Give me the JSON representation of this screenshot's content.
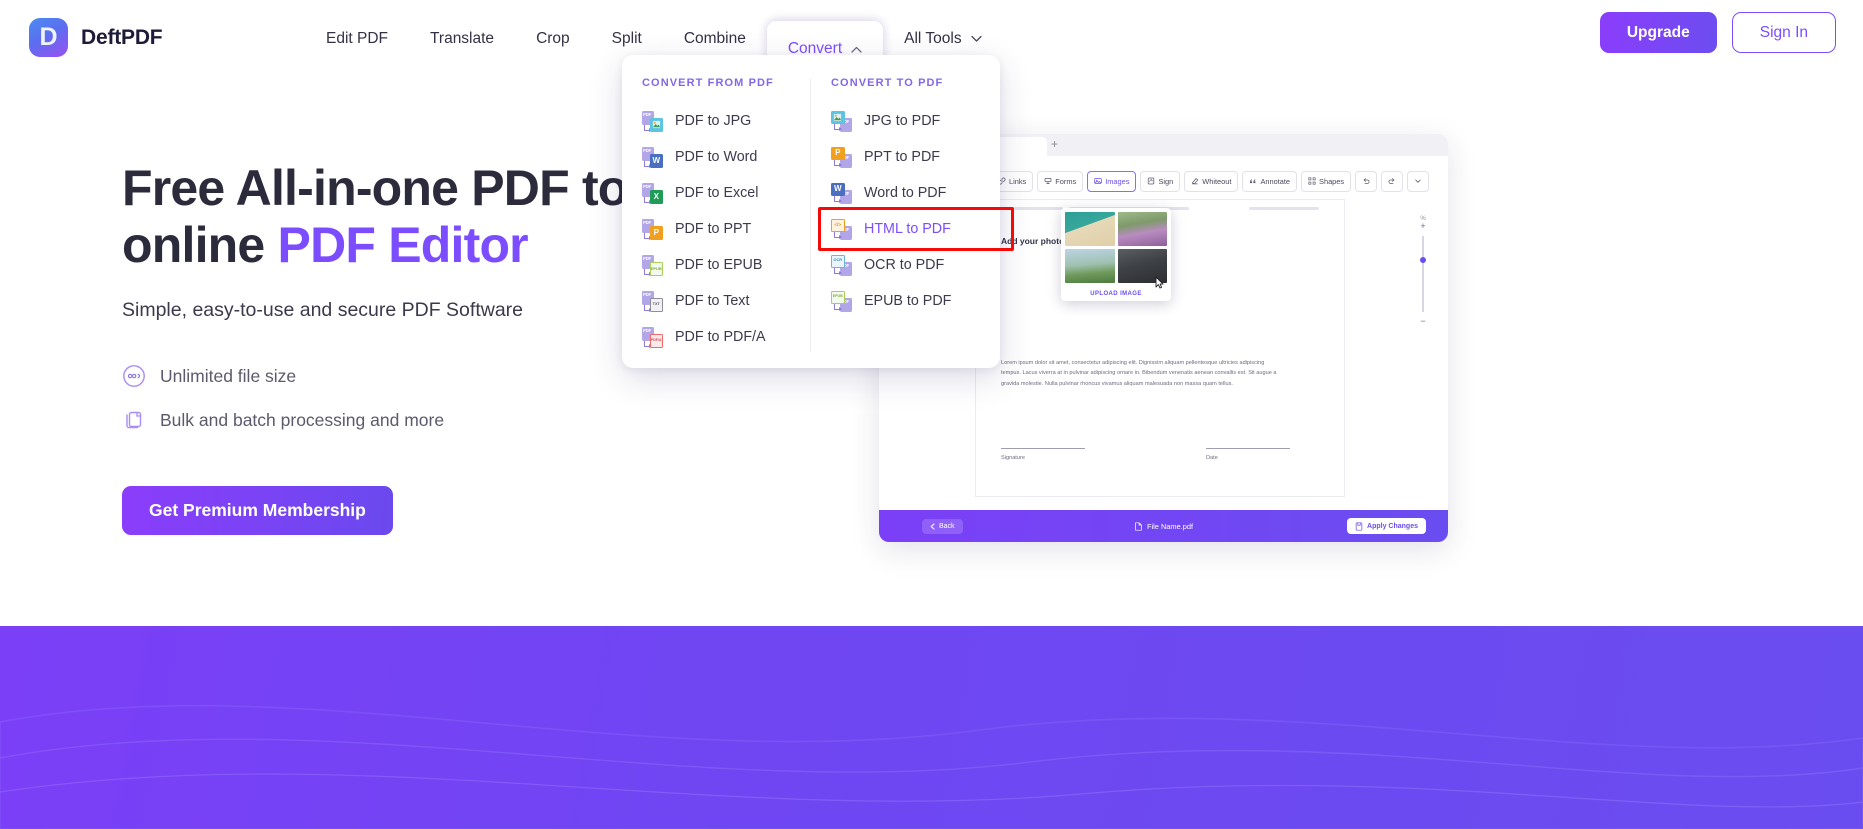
{
  "brand": {
    "name": "DeftPDF",
    "logo_glyph": "D",
    "accent": "#7c4dff",
    "gradient_from": "#8b3dfb",
    "gradient_to": "#6a4df0"
  },
  "header": {
    "nav": [
      {
        "label": "Edit PDF",
        "active": false
      },
      {
        "label": "Translate",
        "active": false
      },
      {
        "label": "Crop",
        "active": false
      },
      {
        "label": "Split",
        "active": false
      },
      {
        "label": "Combine",
        "active": false
      },
      {
        "label": "Convert",
        "active": true,
        "chevron": "chevron-up-icon"
      },
      {
        "label": "All Tools",
        "active": false,
        "chevron": "chevron-down-icon"
      }
    ],
    "upgrade_label": "Upgrade",
    "signin_label": "Sign In"
  },
  "dropdown": {
    "open": true,
    "highlight_color": "#f50a0a",
    "columns": [
      {
        "heading": "CONVERT FROM PDF",
        "items": [
          {
            "label": "PDF to JPG",
            "chip": "",
            "chip_color": "#5cc3e0",
            "highlighted": false
          },
          {
            "label": "PDF to Word",
            "chip": "W",
            "chip_color": "#4a6fc0",
            "highlighted": false
          },
          {
            "label": "PDF to Excel",
            "chip": "X",
            "chip_color": "#1f9d58",
            "highlighted": false
          },
          {
            "label": "PDF to PPT",
            "chip": "P",
            "chip_color": "#f0a01e",
            "highlighted": false
          },
          {
            "label": "PDF to EPUB",
            "chip": "",
            "chip_color": "#a8cf5a",
            "highlighted": false
          },
          {
            "label": "PDF to Text",
            "chip": "TXT",
            "chip_color": "#8e8e9e",
            "highlighted": false
          },
          {
            "label": "PDF to PDF/A",
            "chip": "A",
            "chip_color": "#ef6a6a",
            "highlighted": false
          }
        ]
      },
      {
        "heading": "CONVERT TO PDF",
        "items": [
          {
            "label": "JPG to PDF",
            "chip": "",
            "chip_color": "#5cc3e0",
            "highlighted": false
          },
          {
            "label": "PPT to PDF",
            "chip": "P",
            "chip_color": "#f0a01e",
            "highlighted": false
          },
          {
            "label": "Word to PDF",
            "chip": "W",
            "chip_color": "#4a6fc0",
            "highlighted": false
          },
          {
            "label": "HTML to PDF",
            "chip": "</>",
            "chip_color": "#f0a01e",
            "highlighted": true
          },
          {
            "label": "OCR to PDF",
            "chip": "OCR",
            "chip_color": "#6fb4dd",
            "highlighted": false
          },
          {
            "label": "EPUB to PDF",
            "chip": "EPUB",
            "chip_color": "#a8cf5a",
            "highlighted": false
          }
        ]
      }
    ]
  },
  "hero": {
    "title_line1": "Free All-in-one PDF tools",
    "title_line2_prefix": "online ",
    "title_line2_accent": "PDF Editor",
    "subtitle": "Simple, easy-to-use and secure PDF Software",
    "features": [
      {
        "icon": "infinity-icon",
        "label": "Unlimited file size"
      },
      {
        "icon": "copy-pages-icon",
        "label": "Bulk and batch processing and more"
      }
    ],
    "cta_label": "Get Premium Membership"
  },
  "mockup": {
    "toolbar": [
      {
        "label": "Links",
        "icon": "link-icon",
        "selected": false
      },
      {
        "label": "Forms",
        "icon": "form-icon",
        "selected": false
      },
      {
        "label": "Images",
        "icon": "image-icon",
        "selected": true
      },
      {
        "label": "Sign",
        "icon": "sign-icon",
        "selected": false
      },
      {
        "label": "Whiteout",
        "icon": "eraser-icon",
        "selected": false
      },
      {
        "label": "Annotate",
        "icon": "quote-icon",
        "selected": false
      },
      {
        "label": "Shapes",
        "icon": "shapes-icon",
        "selected": false
      },
      {
        "label": "",
        "icon": "undo-icon",
        "selected": false
      },
      {
        "label": "",
        "icon": "redo-icon",
        "selected": false
      },
      {
        "label": "",
        "icon": "chevron-down-icon",
        "selected": false
      }
    ],
    "document": {
      "heading": "Add your photo",
      "body": "Lorem ipsum dolor sit amet, consectetur adipiscing elit. Dignissim aliquam pellentesque ultricies adipiscing tempus. Lacus viverra at in pulvinar adipiscing ornare in. Bibendum venenatis aenean convallis est. Sit augue a gravida molestie. Nulla pulvinar rhoncus vivamus aliquam malesuada non massa quam tellus.",
      "signature_label": "Signature",
      "date_label": "Date"
    },
    "image_popover": {
      "upload_label": "UPLOAD IMAGE",
      "thumbnails": [
        "bread-bowl-photo",
        "lilac-flowers-photo",
        "child-in-field-photo",
        "man-portrait-photo"
      ]
    },
    "zoom": {
      "percent_label": "%",
      "plus": "+",
      "minus": "−"
    },
    "footer": {
      "back_label": "Back",
      "file_name": "File Name.pdf",
      "apply_label": "Apply Changes"
    }
  }
}
